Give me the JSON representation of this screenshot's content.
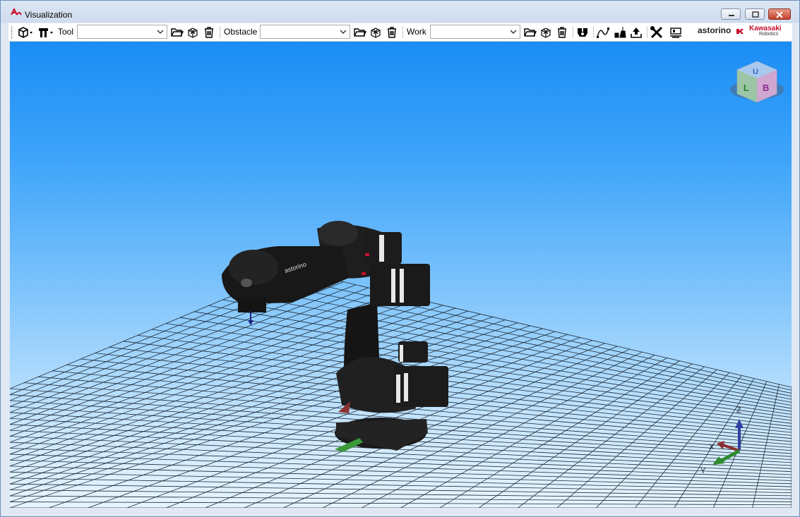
{
  "window": {
    "title": "Visualization"
  },
  "toolbar": {
    "tool_label": "Tool",
    "tool_value": "",
    "obstacle_label": "Obstacle",
    "obstacle_value": "",
    "work_label": "Work",
    "work_value": ""
  },
  "brand": {
    "astorino": "astorino",
    "kawasaki": "Kawasaki",
    "robotics": "Robotics"
  },
  "view_cube": {
    "faces": [
      "U",
      "L",
      "B"
    ]
  },
  "axes": {
    "x": "X",
    "y": "Y",
    "z": "Z"
  },
  "colors": {
    "accent": "#c8102e",
    "sky_top": "#1a8df5",
    "sky_bottom": "#e7f4ff",
    "grid": "#1d2a36"
  }
}
